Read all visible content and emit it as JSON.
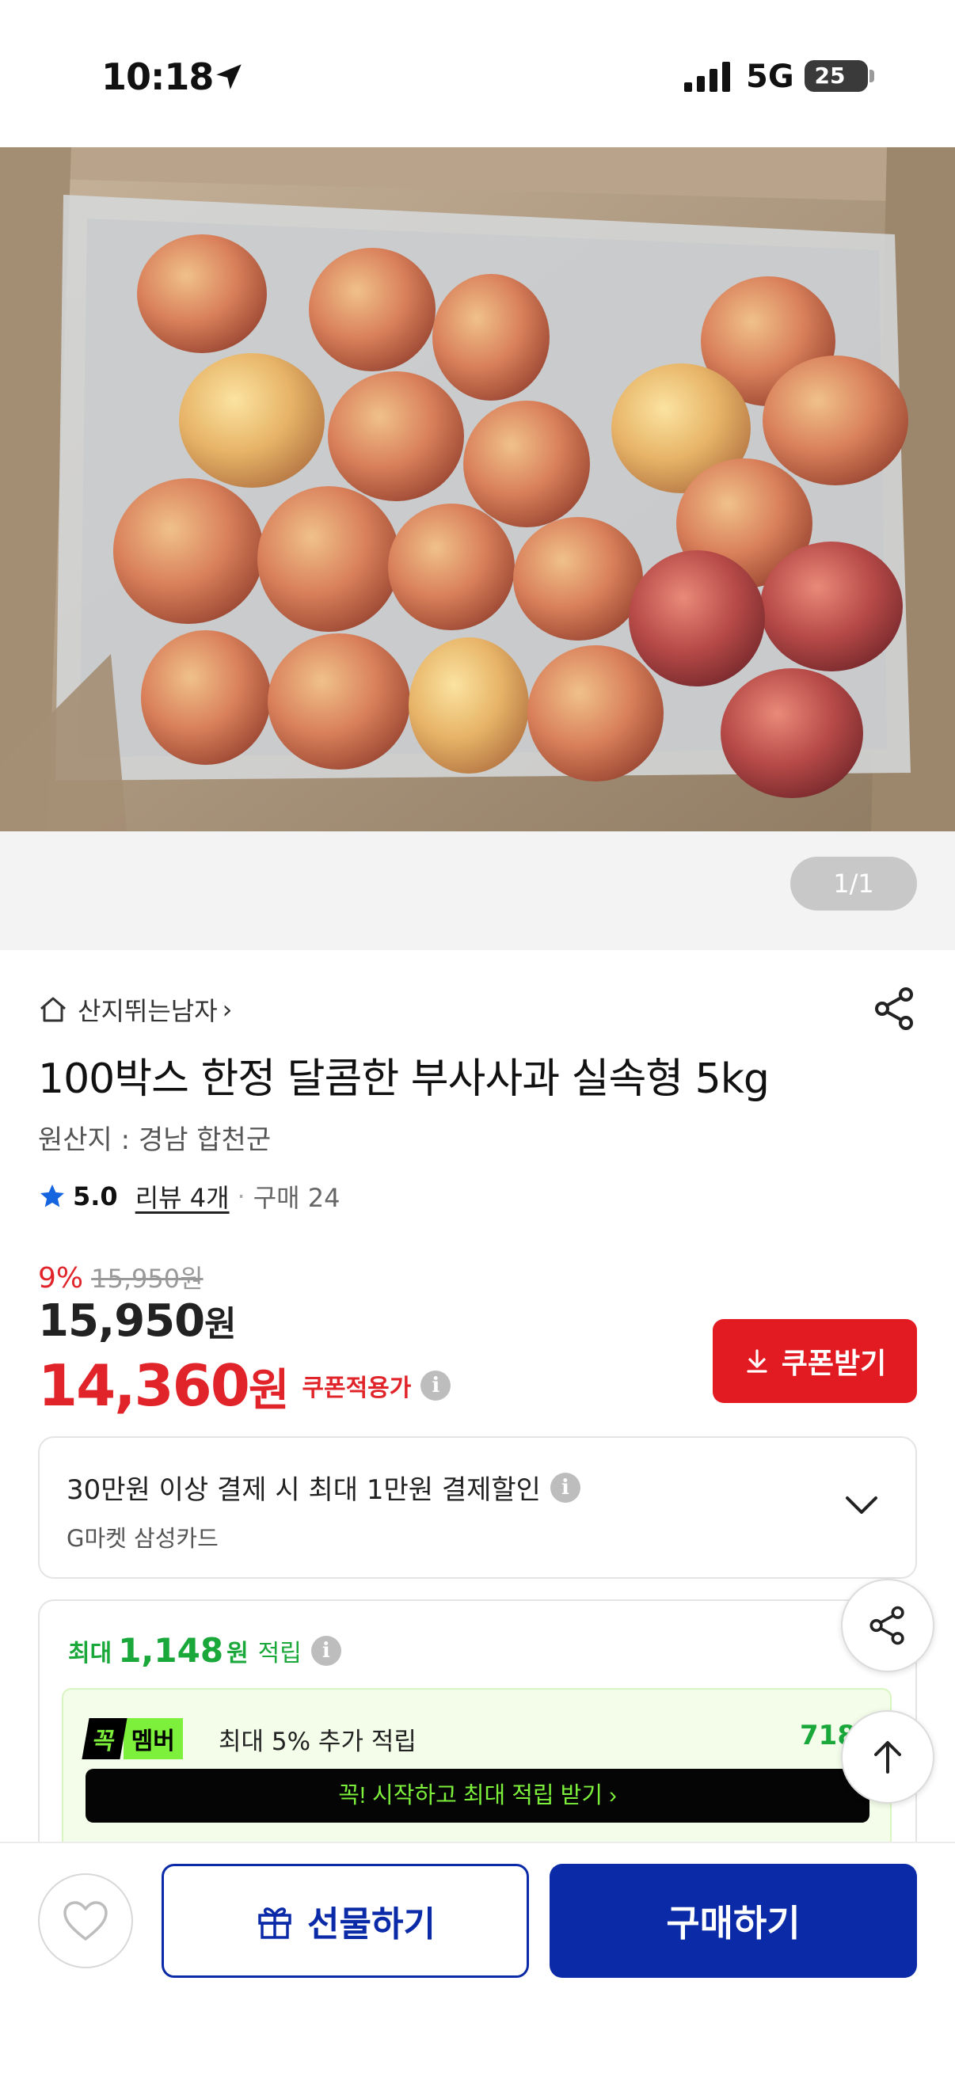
{
  "status_bar": {
    "time": "10:18",
    "network": "5G",
    "battery": "25"
  },
  "gallery": {
    "counter": "1/1",
    "image_alt": "apples-in-box-photo"
  },
  "store": {
    "name": "산지뛰는남자",
    "chevron": "›"
  },
  "product": {
    "title": "100박스 한정 달콤한 부사사과 실속형 5kg",
    "origin": "원산지 : 경남 합천군",
    "rating": "5.0",
    "review_label": "리뷰 4개",
    "purchase_label": "구매 24",
    "discount_pct": "9%",
    "original_price": "15,950원",
    "price_number": "15,950",
    "price_unit": "원",
    "coupon_price_number": "14,360",
    "coupon_price_unit": "원",
    "coupon_label": "쿠폰적용가",
    "coupon_button": "쿠폰받기"
  },
  "card_benefit": {
    "line1": "30만원 이상 결제 시 최대 1만원 결제할인",
    "line2": "G마켓 삼성카드"
  },
  "points": {
    "prefix": "최대",
    "amount": "1,148",
    "unit": "원",
    "suffix": "적립",
    "member_badge_a": "꼭",
    "member_badge_b": "멤버",
    "member_text": "최대 5% 추가 적립",
    "member_amount": "718",
    "member_cta": "꼭! 시작하고 최대 적립 받기 ›"
  },
  "bottom_bar": {
    "gift_label": "선물하기",
    "buy_label": "구매하기"
  },
  "colors": {
    "brand_blue": "#0a2aa8",
    "sale_red": "#e0242a",
    "point_green": "#1aa83b",
    "member_lime": "#7cf03a"
  }
}
